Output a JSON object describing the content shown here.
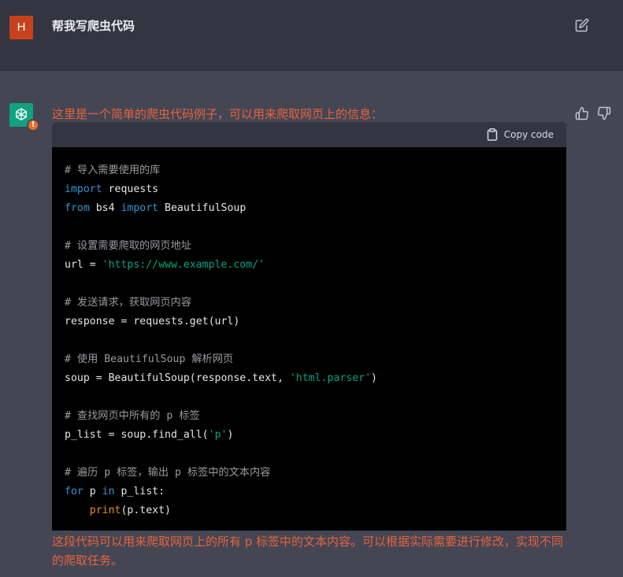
{
  "user": {
    "avatar_letter": "H",
    "message": "帮我写爬虫代码"
  },
  "assistant": {
    "intro": "这里是一个简单的爬虫代码例子，可以用来爬取网页上的信息：",
    "copy_label": "Copy code",
    "outro": "这段代码可以用来爬取网页上的所有 p 标签中的文本内容。可以根据实际需要进行修改，实现不同的爬取任务。",
    "code": {
      "c1": "# 导入需要使用的库",
      "l2_kw": "import",
      "l2_rest": " requests",
      "l3_kw1": "from",
      "l3_mid": " bs4 ",
      "l3_kw2": "import",
      "l3_rest": " BeautifulSoup",
      "c5": "# 设置需要爬取的网页地址",
      "l6_a": "url = ",
      "l6_str": "'https://www.example.com/'",
      "c8": "# 发送请求，获取网页内容",
      "l9": "response = requests.get(url)",
      "c11": "# 使用 BeautifulSoup 解析网页",
      "l12_a": "soup = BeautifulSoup(response.text, ",
      "l12_str": "'html.parser'",
      "l12_b": ")",
      "c14": "# 查找网页中所有的 p 标签",
      "l15_a": "p_list = soup.find_all(",
      "l15_str": "'p'",
      "l15_b": ")",
      "c17": "# 遍历 p 标签，输出 p 标签中的文本内容",
      "l18_kw1": "for",
      "l18_mid": " p ",
      "l18_kw2": "in",
      "l18_rest": " p_list:",
      "l19_indent": "    ",
      "l19_fn": "print",
      "l19_rest": "(p.text)"
    }
  },
  "colors": {
    "accent_text": "#e8633c",
    "user_avatar": "#c7421c",
    "gpt_avatar": "#10a37f"
  }
}
